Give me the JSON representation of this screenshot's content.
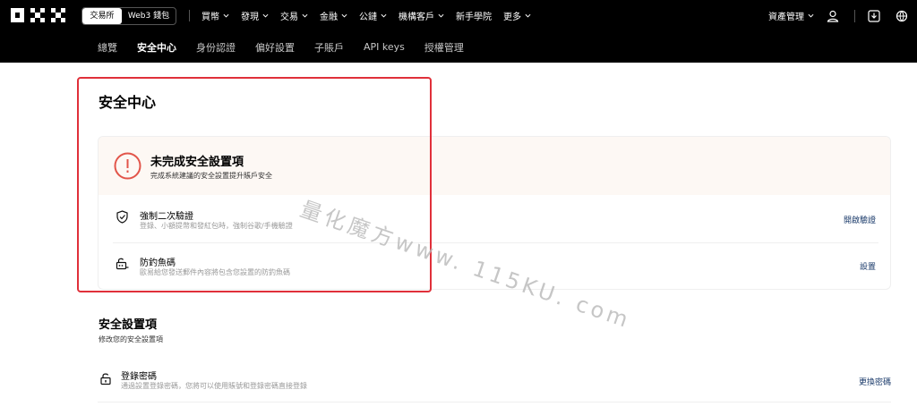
{
  "topbar": {
    "logo_label": "OKX",
    "switch": {
      "exchange": "交易所",
      "wallet": "Web3 錢包"
    },
    "nav": [
      {
        "label": "買幣",
        "has_chevron": true
      },
      {
        "label": "發現",
        "has_chevron": true
      },
      {
        "label": "交易",
        "has_chevron": true
      },
      {
        "label": "金融",
        "has_chevron": true
      },
      {
        "label": "公鏈",
        "has_chevron": true
      },
      {
        "label": "機構客戶",
        "has_chevron": true
      },
      {
        "label": "新手學院",
        "has_chevron": false
      },
      {
        "label": "更多",
        "has_chevron": true
      }
    ],
    "assets_label": "資產管理",
    "icons": [
      "user-icon",
      "download-icon",
      "language-icon"
    ]
  },
  "subnav": {
    "tabs": [
      "總覽",
      "安全中心",
      "身份認證",
      "偏好設置",
      "子賬戶",
      "API keys",
      "授權管理"
    ],
    "active": "安全中心"
  },
  "page": {
    "title": "安全中心"
  },
  "incomplete": {
    "title": "未完成安全設置項",
    "subtitle": "完成系統建議的安全設置提升賬戶安全",
    "items": [
      {
        "title": "強制二次驗證",
        "desc": "登錄、小額提幣和發紅包時，強制谷歌/手機驗證",
        "action": "開啟驗證",
        "icon": "shield-check-icon"
      },
      {
        "title": "防釣魚碼",
        "desc": "歐易給您發送郵件內容將包含您設置的防釣魚碼",
        "action": "設置",
        "icon": "lock-code-icon"
      }
    ]
  },
  "settings": {
    "title": "安全設置項",
    "subtitle": "修改您的安全設置項",
    "items": [
      {
        "title": "登錄密碼",
        "desc": "通過設置登錄密碼，您將可以使用賬號和登錄密碼直接登錄",
        "action": "更換密碼",
        "icon": "unlock-icon"
      }
    ]
  },
  "watermark": "量化魔方www. 115KU. com",
  "colors": {
    "highlight_border": "#e0303a",
    "alert_bg": "#fdf8f4",
    "alert_icon": "#e2554a",
    "link": "#1a3a6a"
  }
}
